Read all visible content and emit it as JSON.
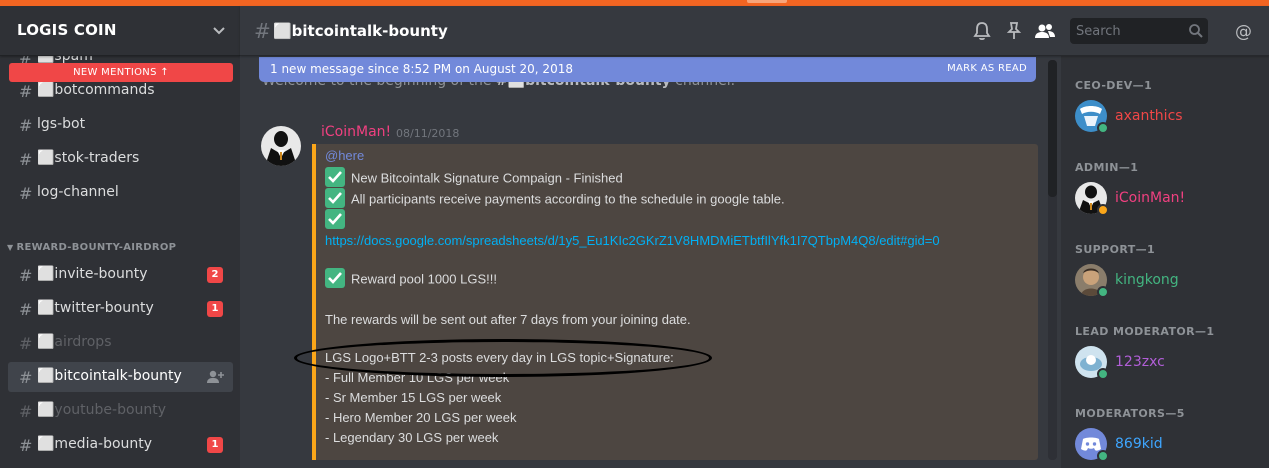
{
  "server": {
    "name": "LOGIS COIN"
  },
  "new_mentions": "NEW MENTIONS",
  "channels_top": [
    {
      "name": "⬜spam"
    },
    {
      "name": "⬜botcommands"
    },
    {
      "name": "lgs-bot"
    },
    {
      "name": "⬜stok-traders"
    },
    {
      "name": "log-channel"
    }
  ],
  "category": "REWARD-BOUNTY-AIRDROP",
  "channels_bounty": [
    {
      "name": "⬜invite-bounty",
      "badge": "2"
    },
    {
      "name": "⬜twitter-bounty",
      "badge": "1"
    },
    {
      "name": "⬜airdrops"
    },
    {
      "name": "⬜bitcointalk-bounty"
    },
    {
      "name": "⬜youtube-bounty"
    },
    {
      "name": "⬜media-bounty",
      "badge": "1"
    }
  ],
  "chat": {
    "channel_title": "⬜bitcointalk-bounty",
    "search_placeholder": "Search",
    "new_message_bar": "1 new message since 8:52 PM on August 20, 2018",
    "mark_as_read": "MARK AS READ",
    "welcome_prefix": "Welcome to the beginning of the ",
    "welcome_channel": "#⬜bitcointalk-bounty",
    "welcome_suffix": " channel."
  },
  "message": {
    "author": "iCoinMan!",
    "timestamp": "08/11/2018",
    "mention": "@here",
    "line1": "New Bitcointalk Signature Compaign - Finished",
    "line2": "All participants receive payments according to the schedule in google table.",
    "link": "https://docs.google.com/spreadsheets/d/1y5_Eu1KIc2GKrZ1V8HMDMiETbtfIlYfk1I7QTbpM4Q8/edit#gid=0",
    "reward": "Reward pool 1000 LGS!!!",
    "rewards_note": "The rewards will be sent out after 7 days from your joining date.",
    "rule_heading": "LGS Logo+BTT 2-3 posts every day in LGS topic+Signature:",
    "tiers": [
      "- Full Member 10 LGS per week",
      "- Sr Member 15 LGS per week",
      "- Hero Member 20 LGS per week",
      "- Legendary 30 LGS per week"
    ]
  },
  "members": {
    "roles": [
      {
        "label": "CEO-DEV—1",
        "name": "axanthics",
        "color": "#f04747",
        "status": "#43b581"
      },
      {
        "label": "ADMIN—1",
        "name": "iCoinMan!",
        "color": "#f04080",
        "status": "#faa61a"
      },
      {
        "label": "SUPPORT—1",
        "name": "kingkong",
        "color": "#43b581",
        "status": "#43b581"
      },
      {
        "label": "LEAD MODERATOR—1",
        "name": "123zxc",
        "color": "#b15ed7",
        "status": "#43b581"
      },
      {
        "label": "MODERATORS—5",
        "name": "869kid",
        "color": "#3ea6ff",
        "status": "#43b581"
      }
    ]
  }
}
